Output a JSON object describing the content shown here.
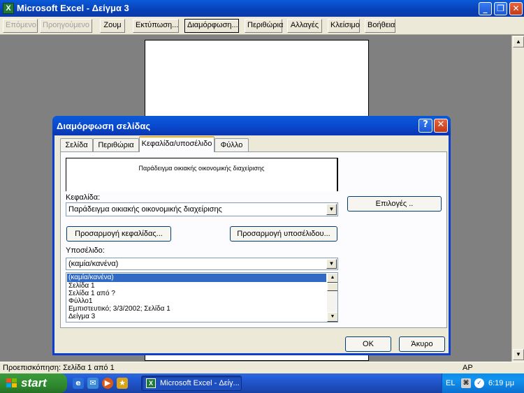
{
  "window": {
    "title": "Microsoft Excel - Δείγμα 3"
  },
  "toolbar": {
    "next": "Επόμενο",
    "previous": "Προηγούμενο",
    "zoom": "Ζουμ",
    "print": "Εκτύπωση...",
    "setup": "Διαμόρφωση...",
    "margins": "Περιθώρια",
    "page_break": "Αλλαγές",
    "close": "Κλείσιμο",
    "help": "Βοήθεια"
  },
  "status": {
    "text": "Προεπισκόπηση: Σελίδα 1 από 1",
    "mode": "ΑΡ"
  },
  "taskbar": {
    "start": "start",
    "task": "Microsoft Excel - Δείγ...",
    "lang": "EL",
    "clock": "6:19 μμ"
  },
  "dialog": {
    "title": "Διαμόρφωση σελίδας",
    "tabs": [
      "Σελίδα",
      "Περιθώρια",
      "Κεφαλίδα/υποσέλιδο",
      "Φύλλο"
    ],
    "header_preview": "Παράδειγμα οικιακής οικονομικής διαχείρισης",
    "header_label": "Κεφαλίδα:",
    "header_value": "Παράδειγμα οικιακής οικονομικής διαχείρισης",
    "options_button": "Επιλογές ..",
    "custom_header_button": "Προσαρμογή κεφαλίδας...",
    "custom_footer_button": "Προσαρμογή υποσέλιδου...",
    "footer_label": "Υποσέλιδο:",
    "footer_value": "(καμία/κανένα)",
    "footer_options": [
      "(καμία/κανένα)",
      "Σελίδα 1",
      "Σελίδα 1 από ?",
      "Φύλλο1",
      " Εμπιστευτικό; 3/3/2002; Σελίδα 1",
      "Δείγμα 3"
    ],
    "ok": "OK",
    "cancel": "Άκυρο"
  }
}
